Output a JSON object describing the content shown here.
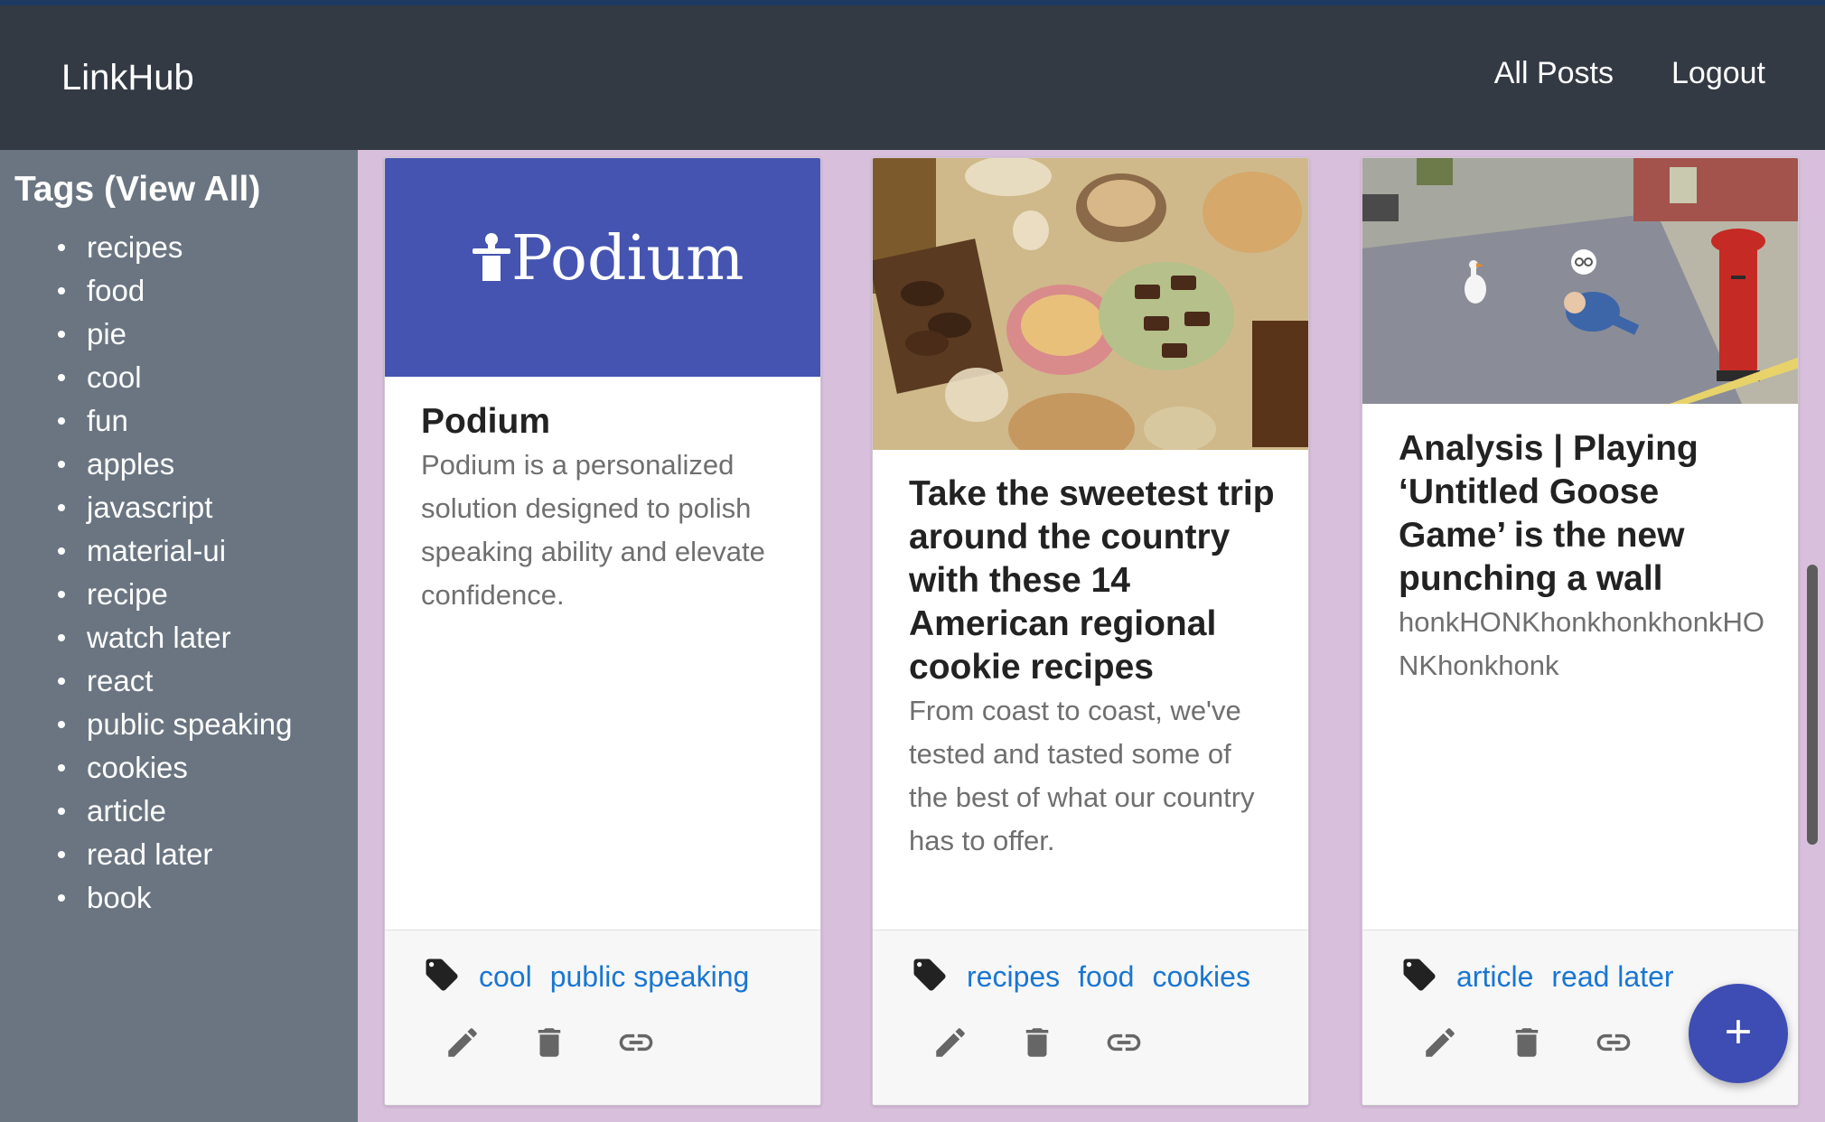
{
  "header": {
    "brand": "LinkHub",
    "nav": [
      "All Posts",
      "Logout"
    ]
  },
  "sidebar": {
    "title": "Tags (View All)",
    "tags": [
      "recipes",
      "food",
      "pie",
      "cool",
      "fun",
      "apples",
      "javascript",
      "material-ui",
      "recipe",
      "watch later",
      "react",
      "public speaking",
      "cookies",
      "article",
      "read later",
      "book"
    ]
  },
  "posts": [
    {
      "logo_text": "Podium",
      "title": "Podium",
      "description": "Podium is a personalized solution designed to polish speaking ability and elevate confidence.",
      "tags": [
        "cool",
        "public speaking"
      ]
    },
    {
      "title": "Take the sweetest trip around the country with these 14 American regional cookie recipes",
      "description": "From coast to coast, we've tested and tasted some of the best of what our country has to offer.",
      "tags": [
        "recipes",
        "food",
        "cookies"
      ]
    },
    {
      "title": "Analysis | Playing ‘Untitled Goose Game’ is the new punching a wall",
      "description": "honkHONKhonkhonkhonkHONKhonkhonk",
      "tags": [
        "article",
        "read later"
      ]
    }
  ],
  "icons": {
    "tag": "tag-icon",
    "edit": "pencil-icon",
    "delete": "trash-icon",
    "link": "link-icon",
    "fab": "plus-icon"
  },
  "colors": {
    "appbar": "#343a44",
    "sidebar": "#6a7581",
    "background": "#d8bfdc",
    "link": "#1976d2",
    "fab": "#3e4db3",
    "podium": "#4554b0"
  }
}
